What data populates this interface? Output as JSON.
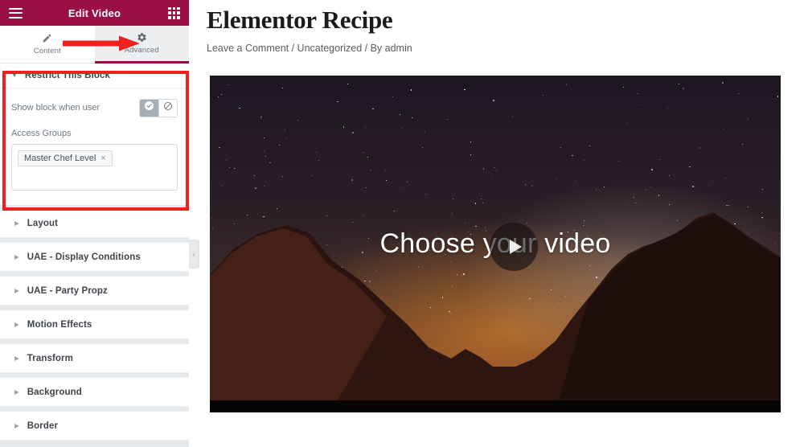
{
  "panel": {
    "header": {
      "title": "Edit Video",
      "menu_icon": "hamburger-icon",
      "apps_icon": "grid-apps-icon"
    },
    "tabs": [
      {
        "label": "Content",
        "icon": "pencil-icon",
        "active": false
      },
      {
        "label": "Advanced",
        "icon": "gear-icon",
        "active": true
      }
    ],
    "open_section": {
      "title": "Restrict This Block",
      "controls": {
        "show_block_label": "Show block when user",
        "choices": [
          {
            "icon": "check-icon",
            "selected": true
          },
          {
            "icon": "prohibited-icon",
            "selected": false
          }
        ],
        "access_groups_label": "Access Groups",
        "access_groups_tags": [
          {
            "label": "Master Chef Level",
            "remove": "×"
          }
        ]
      }
    },
    "sections": [
      {
        "label": "Layout"
      },
      {
        "label": "UAE - Display Conditions"
      },
      {
        "label": "UAE - Party Propz"
      },
      {
        "label": "Motion Effects"
      },
      {
        "label": "Transform"
      },
      {
        "label": "Background"
      },
      {
        "label": "Border"
      }
    ],
    "collapse_handle": "‹"
  },
  "preview": {
    "title": "Elementor Recipe",
    "meta": "Leave a Comment / Uncategorized / By admin",
    "video": {
      "overlay_text": "Choose your video",
      "play_icon": "play-triangle-icon"
    }
  },
  "annotations": {
    "arrow_color": "#ee2020",
    "box_color": "#ee2020"
  },
  "colors": {
    "header_bg": "#9b0e42",
    "panel_bg": "#e6e9ec",
    "active_tab_underline": "#8f0f3f"
  }
}
